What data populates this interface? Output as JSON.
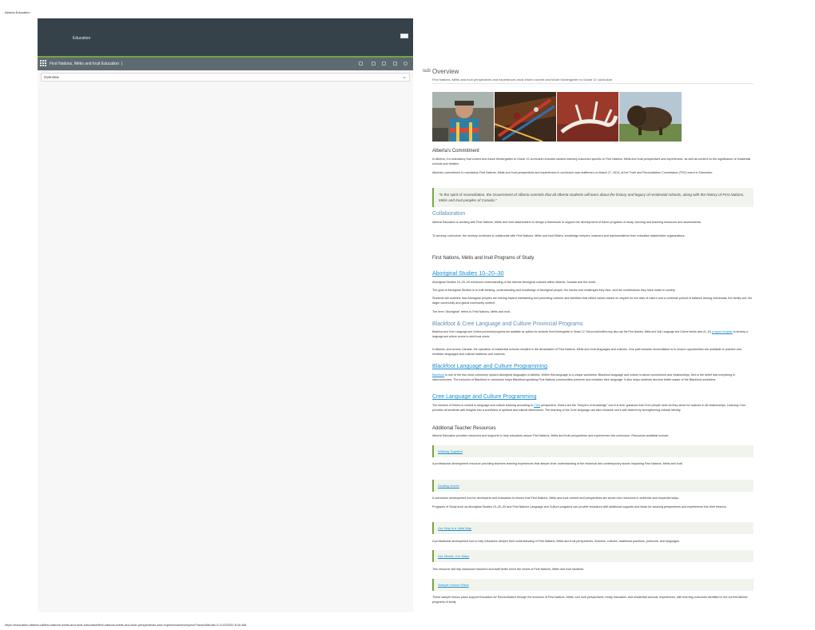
{
  "print": {
    "header": "Alberta Education",
    "footer": "https://education.alberta.ca/first-nations-métis-and-inuit-education/first-nations-métis-and-inuit-perspectives-and-experiences/everyone/?searchMode=3    1/13/2020 8:16 AM"
  },
  "app": {
    "brand": "Education",
    "toolbar_title": "First Nations, Métis and Inuit Education",
    "toolbar_sep": "|",
    "select_value": "Overview"
  },
  "page": {
    "sub_label": "sub",
    "title": "Overview",
    "subtitle": "First Nations, Métis and Inuit perspectives and experiences must inform current and future Kindergarten to Grade 12 curriculum"
  },
  "sections": {
    "commitment": {
      "heading": "Alberta's Commitment",
      "p1": "In Alberta, it is mandatory that current and future Kindergarten to Grade 12 curriculum includes student learning outcomes specific to First Nations, Métis and Inuit perspectives and experiences, as well as content on the significance of residential schools and treaties.",
      "p2": "Alberta's commitment to mandatory First Nations, Métis and Inuit perspectives and experiences in curriculum was reaffirmed on March 27, 2014, at the Truth and Reconciliation Commission (TRC) event in Edmonton.",
      "quote": "\"In the spirit of reconciliation, the Government of Alberta commits that all Alberta students will learn about the history and legacy of residential schools, along with the history of First Nations, Métis and Inuit peoples of Canada.\""
    },
    "collaboration": {
      "heading": "Collaboration",
      "p1": "Alberta Education is working with First Nations, Métis and Inuit stakeholders to design a framework to support the development of future programs of study, learning and teaching resources and assessments.",
      "p2": "To develop curriculum, the ministry continues to collaborate with First Nations, Métis and Inuit Elders, knowledge keepers, teachers and representatives from education stakeholder organizations."
    },
    "programs": {
      "heading": "First Nations, Métis and Inuit Programs of Study",
      "aboriginal_link": "Aboriginal Studies 10–20–30",
      "ab_p1": "Aboriginal Studies 10–20–30 enhances understanding of the diverse Aboriginal cultures within Alberta, Canada and the world.",
      "ab_p2": "The goal of Aboriginal Studies is to shift thinking, understanding and knowledge of Aboriginal people, the issues and challenges they face, and the contributions they have made to society.",
      "ab_p3": "Students will examine how Aboriginal peoples are striving toward maintaining and promoting cultures and identities that reflect values based on respect for the laws of nature and a continual pursuit of balance among individuals, the family unit, the larger community and global community context.",
      "ab_p4": "The term \"Aboriginal\" refers to First Nations, Métis and Inuit.",
      "bc_heading": "Blackfoot & Cree Language and Culture Provincial Programs",
      "bc_p1a": "Blackfoot and Cree Language and Culture provincial programs are available as options for students from Kindergarten to Grade 12. School authorities may also use the First Nations, Métis and Inuit Language and Culture twelve year (K–12)",
      "bc_p1_link": "program template",
      "bc_p1b": "to develop a language and culture course to meet local needs.",
      "bc_p2": "In Alberta, and across Canada, the operation of residential schools resulted in the devastation of First Nations, Métis and Inuit languages and cultures. One path towards reconciliation is to ensure opportunities are available to practice and revitalize languages and cultural traditions and customs.",
      "bf_link": "Blackfoot Language and Culture Programming",
      "bf_word": "Blackfoot",
      "bf_p": "is one of the two most commonly spoken Aboriginal languages in Alberta. Within this language is a unique worldview. Blackfoot language and culture is about connections and relationships, tied to the belief that everything is interconnected. The inclusion of Blackfoot in curriculum helps Blackfoot-speaking First Nations communities preserve and revitalize their language. It also helps students become better aware of the Blackfoot worldview.",
      "cree_link": "Cree Language and Culture Programming",
      "cree_p_a": "The wisdom of Elders is central to language and culture learning according to",
      "cree_word": "Cree",
      "cree_p_b": "perspective. Elders are the \"keepers of knowledge\" and it is their guidance that Cree people seek as they strive for balance in all relationships. Learning Cree provides all students with insights into a worldview of spiritual and natural dimensions. The learning of the Cree language can also enhance one's self-esteem by strengthening cultural identity."
    },
    "resources": {
      "heading": "Additional Teacher Resources",
      "intro": "Alberta Education provides resources and supports to help educators weave First Nations, Métis and Inuit perspectives and experiences into curriculum. Resources available include:",
      "r1_link": "Walking Together",
      "r1_desc": "A professional development resource providing teachers learning experiences that deepen their understanding of the historical and contemporary issues impacting First Nations, Métis and Inuit.",
      "r2_link": "Guiding Voices",
      "r2_desc1": "A curriculum development tool for developers and evaluators to ensure that First Nations, Métis and Inuit content and perspectives are woven into resources in authentic and respectful ways.",
      "r2_desc2": "Programs of Study such as Aboriginal Studies 10–20–30 and First Nations Language and Culture programs can provide educators with additional supports and ideas for weaving perspectives and experiences into their lessons.",
      "r3_link": "Our Way Is a Valid Way",
      "r3_desc": "A professional development tool to help educators deepen their understanding of First Nations, Métis and Inuit perspectives, histories, cultures, traditional practices, protocols, and languages.",
      "r4_link": "Our Words, Our Ways",
      "r4_desc": "This resource will help classroom teachers and staff better serve the needs of First Nations, Métis and Inuit students.",
      "r5_link": "Sample Lesson Plans",
      "r5_desc": "These sample lesson plans support Education for Reconciliation through the inclusion of First Nations, Métis, and Inuit perspectives; treaty education; and residential schools' experiences, with learning outcomes identified in the current Alberta programs of study."
    }
  },
  "colors": {
    "header_bg": "#36424a",
    "accent_green": "#78a341",
    "toolbar_bg": "#5e6a71",
    "link_blue": "#1a8fd0",
    "subheading_blue": "#5c8fb4",
    "callout_bg": "#f1f4ec"
  },
  "icons": [
    "grid-icon",
    "chevron-down-icon",
    "toolbar-icons"
  ]
}
